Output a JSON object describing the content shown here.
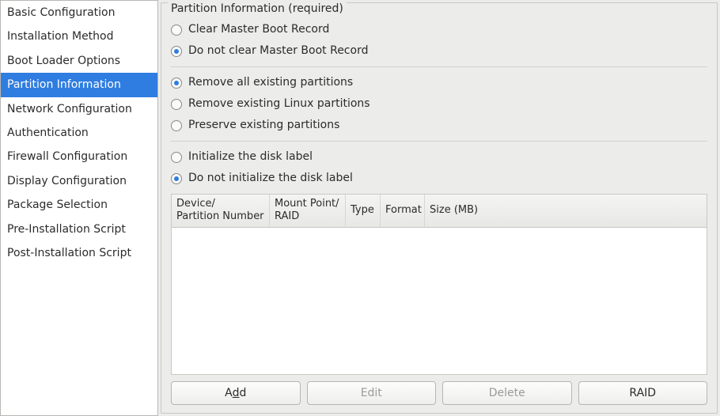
{
  "sidebar": {
    "items": [
      {
        "label": "Basic Configuration",
        "selected": false
      },
      {
        "label": "Installation Method",
        "selected": false
      },
      {
        "label": "Boot Loader Options",
        "selected": false
      },
      {
        "label": "Partition Information",
        "selected": true
      },
      {
        "label": "Network Configuration",
        "selected": false
      },
      {
        "label": "Authentication",
        "selected": false
      },
      {
        "label": "Firewall Configuration",
        "selected": false
      },
      {
        "label": "Display Configuration",
        "selected": false
      },
      {
        "label": "Package Selection",
        "selected": false
      },
      {
        "label": "Pre-Installation Script",
        "selected": false
      },
      {
        "label": "Post-Installation Script",
        "selected": false
      }
    ]
  },
  "panel": {
    "title": "Partition Information (required)",
    "mbr": {
      "opt1": "Clear Master Boot Record",
      "opt2": "Do not clear Master Boot Record",
      "selected": 1
    },
    "partitions": {
      "opt1": "Remove all existing partitions",
      "opt2": "Remove existing Linux partitions",
      "opt3": "Preserve existing partitions",
      "selected": 0
    },
    "disklabel": {
      "opt1": "Initialize the disk label",
      "opt2": "Do not initialize the disk label",
      "selected": 1
    },
    "table": {
      "headers": {
        "device_l1": "Device/",
        "device_l2": "Partition Number",
        "mount_l1": "Mount Point/",
        "mount_l2": "RAID",
        "type": "Type",
        "format": "Format",
        "size": "Size (MB)"
      }
    },
    "buttons": {
      "add_pre": "A",
      "add_accel": "d",
      "add_post": "d",
      "edit": "Edit",
      "delete": "Delete",
      "raid": "RAID"
    }
  }
}
